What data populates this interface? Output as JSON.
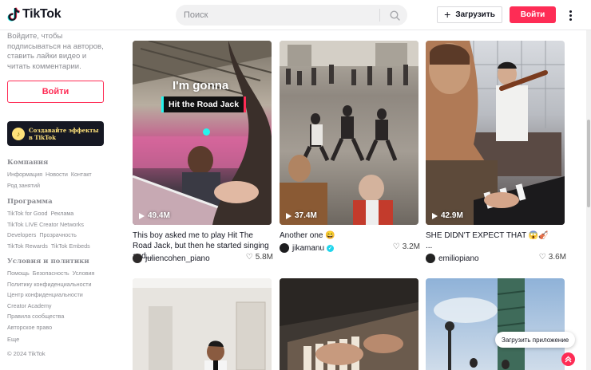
{
  "header": {
    "logo_text": "TikTok",
    "search_placeholder": "Поиск",
    "upload_label": "Загрузить",
    "login_label": "Войти"
  },
  "sidebar": {
    "promo_text": "Войдите, чтобы подписываться на авторов, ставить лайки видео и читать комментарии.",
    "login_label": "Войти",
    "effects_label": "Создавайте эффекты в TikTok",
    "sections": [
      {
        "heading": "Компания",
        "links": [
          "Информация",
          "Новости",
          "Контакт",
          "Род занятий"
        ]
      },
      {
        "heading": "Программа",
        "links": [
          "TikTok for Good",
          "Реклама",
          "TikTok LIVE Creator Networks",
          "Developers",
          "Прозрачность",
          "TikTok Rewards",
          "TikTok Embeds"
        ]
      },
      {
        "heading": "Условия и политики",
        "links": [
          "Помощь",
          "Безопасность",
          "Условия",
          "Политику конфиденциальности",
          "Центр конфиденциальности",
          "Creator Academy",
          "Правила сообщества",
          "Авторское право"
        ]
      }
    ],
    "more_label": "Еще",
    "copyright": "© 2024 TikTok"
  },
  "videos": [
    {
      "views": "49.4M",
      "caption": "This boy asked me to play Hit The Road Jack, but then he started singing and...",
      "author": "juliencohen_piano",
      "verified": false,
      "likes": "5.8M",
      "overlay_line1": "I'm gonna",
      "overlay_line2": "Hit the Road Jack"
    },
    {
      "views": "37.4M",
      "caption": "Another one 😄",
      "author": "jikamanu",
      "verified": true,
      "likes": "3.2M"
    },
    {
      "views": "42.9M",
      "caption": "SHE DIDN'T EXPECT THAT 😱🎻",
      "caption_extra": "...",
      "author": "emiliopiano",
      "verified": false,
      "likes": "3.6M"
    }
  ],
  "toast_text": "Загрузить приложение",
  "colors": {
    "brand_red": "#fe2c55",
    "brand_cyan": "#25f4ee",
    "effects_yellow": "#ffe27a"
  }
}
